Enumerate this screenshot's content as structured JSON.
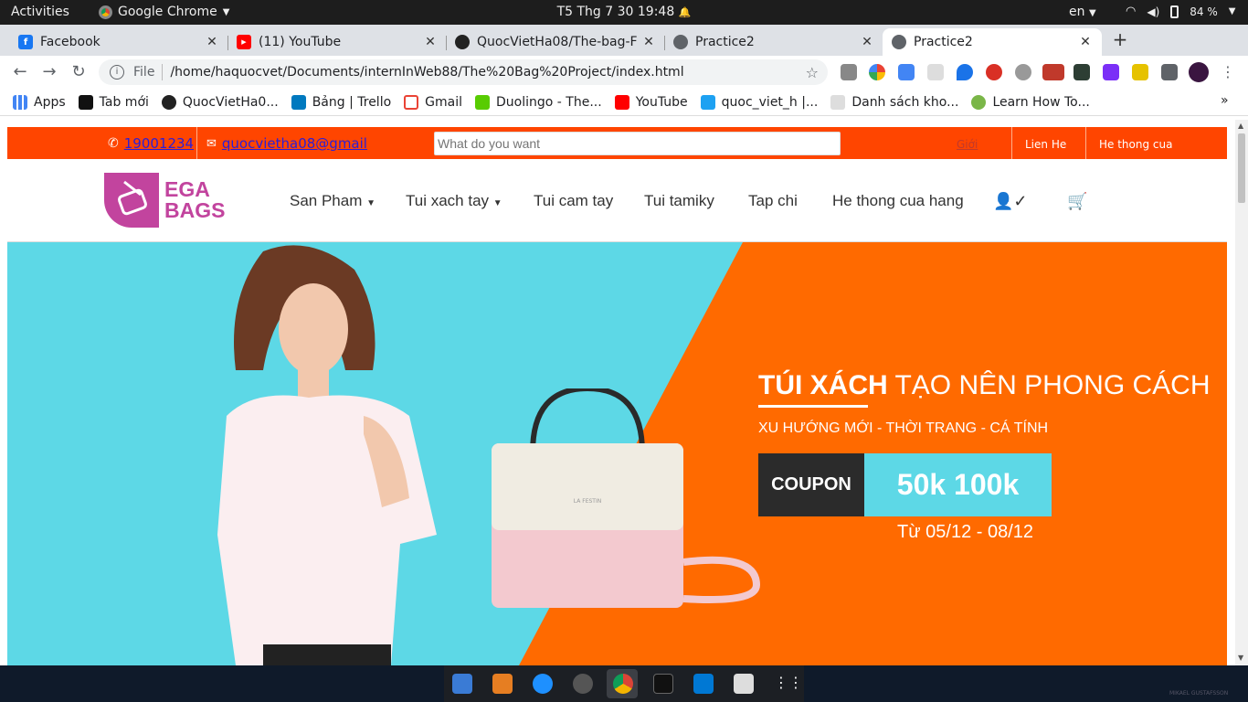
{
  "system": {
    "activities": "Activities",
    "app_name": "Google Chrome",
    "clock": "T5 Thg 7 30  19:48",
    "language": "en",
    "battery": "84 %"
  },
  "tabs": [
    {
      "title": "Facebook",
      "color": "#1877f2",
      "glyph": "f"
    },
    {
      "title": "(11) YouTube",
      "color": "#ff0000",
      "glyph": "▶"
    },
    {
      "title": "QuocVietHa08/The-bag-F",
      "color": "#222222",
      "glyph": "◉"
    },
    {
      "title": "Practice2",
      "color": "#5f6368",
      "glyph": "◍"
    },
    {
      "title": "Practice2",
      "color": "#5f6368",
      "glyph": "◍"
    }
  ],
  "omnibox": {
    "scheme_label": "File",
    "url": "/home/haquocvet/Documents/internInWeb88/The%20Bag%20Project/index.html"
  },
  "bookmarks": [
    {
      "label": "Apps",
      "color": "#4285f4"
    },
    {
      "label": "Tab mới",
      "color": "#111111"
    },
    {
      "label": "QuocVietHa0...",
      "color": "#222222"
    },
    {
      "label": "Bảng | Trello",
      "color": "#0079bf"
    },
    {
      "label": "Gmail",
      "color": "#ea4335"
    },
    {
      "label": "Duolingo - The...",
      "color": "#58cc02"
    },
    {
      "label": "YouTube",
      "color": "#ff0000"
    },
    {
      "label": "quoc_viet_h |...",
      "color": "#1da1f2"
    },
    {
      "label": "Danh sách kho...",
      "color": "#dddddd"
    },
    {
      "label": "Learn How To...",
      "color": "#7ab648"
    }
  ],
  "site": {
    "phone": "19001234",
    "email": "quocvietha08@gmail",
    "search_placeholder": "What do you want",
    "link_intro": "Giới",
    "link_contact": "Lien He",
    "link_stores": "He thong cua",
    "logo_line1": "EGA",
    "logo_line2": "BAGS",
    "nav": [
      "San Pham",
      "Tui xach tay",
      "Tui cam tay",
      "Tui tamiky",
      "Tap chi",
      "He thong cua hang"
    ]
  },
  "banner": {
    "title_bold": "TÚI XÁCH",
    "title_rest": " TẠO NÊN PHONG CÁCH",
    "subtitle": "XU HƯỚNG MỚI - THỜI TRANG - CÁ TÍNH",
    "coupon_label": "COUPON",
    "coupon_value": "50k 100k",
    "date_range": "Từ 05/12  -  08/12",
    "brand_on_bag": "LA FESTIN",
    "colors": {
      "cyan": "#5dd8e6",
      "orange": "#ff6a00",
      "strip": "#ff4500",
      "brand": "#c2449e"
    }
  },
  "dock_watermark": "MIKAEL GUSTAFSSON"
}
